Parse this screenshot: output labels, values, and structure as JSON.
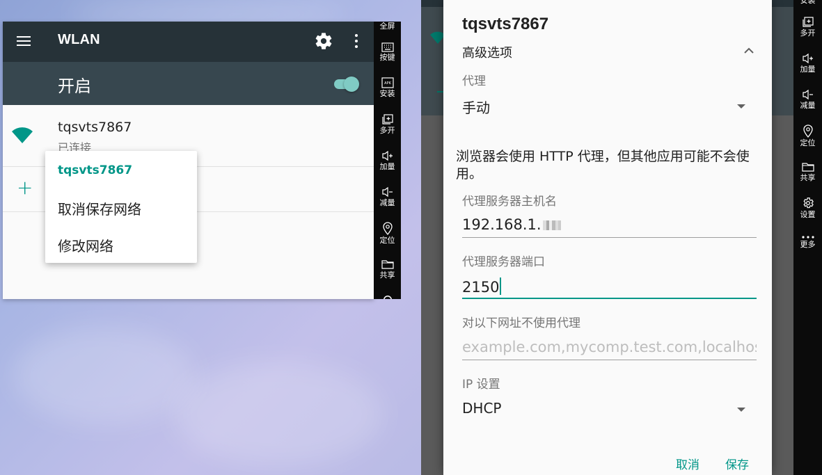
{
  "left": {
    "appbar": {
      "title": "WLAN"
    },
    "switchbar": {
      "label": "开启",
      "on": true
    },
    "network": {
      "ssid": "tqsvts7867",
      "status": "已连接"
    },
    "add_symbol": "+",
    "context_menu": {
      "header": "tqsvts7867",
      "items": [
        "取消保存网络",
        "修改网络"
      ]
    }
  },
  "left_sidebar": {
    "items": [
      {
        "label": "全屏",
        "icon": "fullscreen-icon"
      },
      {
        "label": "按键",
        "icon": "keyboard-icon"
      },
      {
        "label": "安装",
        "icon": "apk-icon"
      },
      {
        "label": "多开",
        "icon": "multi-open-icon"
      },
      {
        "label": "加量",
        "icon": "volume-up-icon"
      },
      {
        "label": "减量",
        "icon": "volume-down-icon"
      },
      {
        "label": "定位",
        "icon": "location-icon"
      },
      {
        "label": "共享",
        "icon": "folder-icon"
      }
    ]
  },
  "right_sidebar": {
    "items": [
      {
        "label": "安装",
        "icon": "apk-icon"
      },
      {
        "label": "多开",
        "icon": "multi-open-icon"
      },
      {
        "label": "加量",
        "icon": "volume-up-icon"
      },
      {
        "label": "减量",
        "icon": "volume-down-icon"
      },
      {
        "label": "定位",
        "icon": "location-icon"
      },
      {
        "label": "共享",
        "icon": "folder-icon"
      },
      {
        "label": "设置",
        "icon": "gear-icon"
      },
      {
        "label": "更多",
        "icon": "more-icon"
      }
    ]
  },
  "dialog": {
    "title": "tqsvts7867",
    "advanced_label": "高级选项",
    "proxy": {
      "label": "代理",
      "value": "手动"
    },
    "warning": "浏览器会使用 HTTP 代理，但其他应用可能不会使用。",
    "hostname": {
      "label": "代理服务器主机名",
      "value": "192.168.1."
    },
    "port": {
      "label": "代理服务器端口",
      "value": "2150"
    },
    "bypass": {
      "label": "对以下网址不使用代理",
      "placeholder": "example.com,mycomp.test.com,localhost"
    },
    "ip": {
      "label": "IP 设置",
      "value": "DHCP"
    },
    "cancel": "取消",
    "save": "保存"
  },
  "colors": {
    "accent": "#009688",
    "appbar": "#263238",
    "switchbar": "#37474f",
    "sidebar": "#0b0b0b"
  }
}
